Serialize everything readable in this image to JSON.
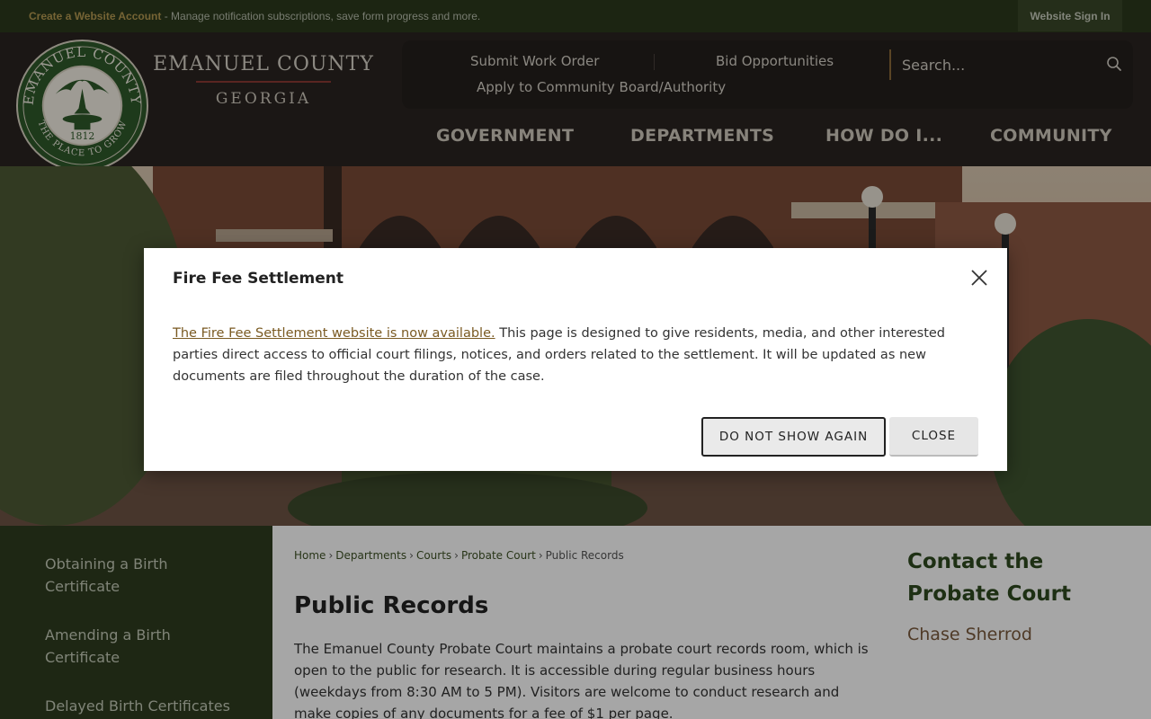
{
  "topbar": {
    "create_account_link": "Create a Website Account",
    "message": " - Manage notification subscriptions, save form progress and more.",
    "sign_in": "Website Sign In"
  },
  "header": {
    "seal": {
      "top_text": "EMANUEL COUNTY",
      "bottom_text": "THE PLACE TO GROW",
      "year": "1812"
    },
    "county_name": "EMANUEL COUNTY",
    "state_name": "GEORGIA",
    "utility_links": [
      {
        "label": "Submit Work Order"
      },
      {
        "label": "Bid Opportunities"
      },
      {
        "label": "Apply to Community Board/Authority"
      }
    ],
    "search": {
      "placeholder": "Search...",
      "icon": "search-icon"
    },
    "nav": [
      {
        "label": "GOVERNMENT"
      },
      {
        "label": "DEPARTMENTS"
      },
      {
        "label": "HOW DO I..."
      },
      {
        "label": "COMMUNITY"
      }
    ]
  },
  "sidebar": {
    "items": [
      {
        "label": "Obtaining a Birth Certificate"
      },
      {
        "label": "Amending a Birth Certificate"
      },
      {
        "label": "Delayed Birth Certificates"
      }
    ]
  },
  "breadcrumb": [
    "Home",
    "Departments",
    "Courts",
    "Probate Court",
    "Public Records"
  ],
  "page": {
    "title": "Public Records",
    "body": "The Emanuel County Probate Court maintains a probate court records room, which is open to the public for research. It is accessible during regular business hours (weekdays from 8:30 AM to 5 PM). Visitors are welcome to conduct research and make copies of any documents for a fee of $1 per page."
  },
  "contact": {
    "title": "Contact the Probate Court",
    "name": "Chase Sherrod"
  },
  "modal": {
    "title": "Fire Fee Settlement",
    "link_text": "The Fire Fee Settlement website is now available.",
    "body_text": " This page is designed to give residents, media, and other interested parties direct access to official court filings, notices, and orders related to the settlement. It will be updated as new documents are filed throughout the duration of the case.",
    "do_not_show": "DO NOT SHOW AGAIN",
    "close": "CLOSE",
    "close_icon": "close-icon"
  },
  "colors": {
    "topbar_bg": "#2c3a1c",
    "header_bg": "#2a2421",
    "sidebar_bg": "#2e3d20",
    "accent_gold": "#b59a52",
    "contact_green": "#2e4a1f",
    "contact_brown": "#7a5a3c"
  }
}
